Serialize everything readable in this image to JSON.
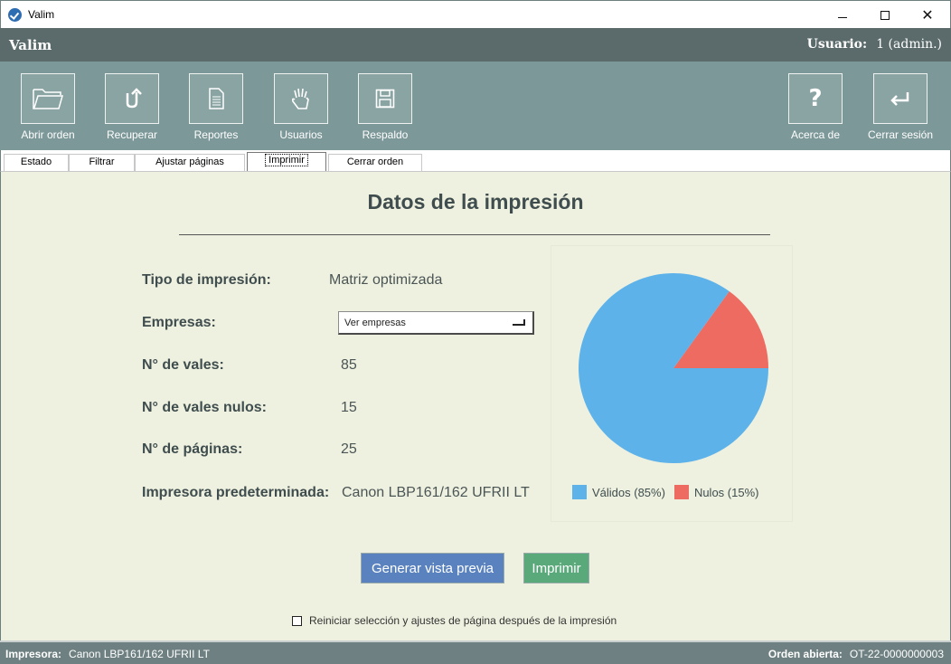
{
  "window": {
    "title": "Valim"
  },
  "header": {
    "app_name": "Valim",
    "user_label": "Usuario:",
    "user_value": "1 (admin.)"
  },
  "toolbar": {
    "left": [
      {
        "label": "Abrir orden",
        "icon": "folder-icon"
      },
      {
        "label": "Recuperar",
        "icon": "undo-icon"
      },
      {
        "label": "Reportes",
        "icon": "document-icon"
      },
      {
        "label": "Usuarios",
        "icon": "hand-icon"
      },
      {
        "label": "Respaldo",
        "icon": "floppy-disk-icon"
      }
    ],
    "right": [
      {
        "label": "Acerca de",
        "icon": "question-icon"
      },
      {
        "label": "Cerrar sesión",
        "icon": "return-icon"
      }
    ]
  },
  "tabs": [
    {
      "label": "Estado"
    },
    {
      "label": "Filtrar"
    },
    {
      "label": "Ajustar páginas"
    },
    {
      "label": "Imprimir",
      "active": true
    },
    {
      "label": "Cerrar orden"
    }
  ],
  "main": {
    "heading": "Datos de la impresión",
    "rows": [
      {
        "label": "Tipo de impresión:",
        "value": "Matriz optimizada"
      },
      {
        "label": "Empresas:",
        "value": ""
      },
      {
        "label": "N° de vales:",
        "value": "85"
      },
      {
        "label": "N° de vales nulos:",
        "value": "15"
      },
      {
        "label": "N° de páginas:",
        "value": "25"
      },
      {
        "label": "Impresora predeterminada:",
        "value": "Canon LBP161/162 UFRII LT"
      }
    ],
    "empresas_select": "Ver empresas",
    "preview_button": "Generar vista previa",
    "print_button": "Imprimir",
    "reset_checkbox_label": "Reiniciar selección y ajustes de página después de la impresión",
    "reset_checked": false
  },
  "chart_data": {
    "type": "pie",
    "categories": [
      "Válidos (85%)",
      "Nulos (15%)"
    ],
    "values": [
      85,
      15
    ],
    "colors": [
      "#5eb2ea",
      "#ee6b62"
    ],
    "legend": "bottom"
  },
  "statusbar": {
    "printer_label": "Impresora:",
    "printer_value": "Canon LBP161/162 UFRII LT",
    "order_label": "Orden abierta:",
    "order_value": "OT-22-0000000003"
  },
  "colors": {
    "header": "#5b6b6c",
    "toolbar": "#7d9899",
    "content_bg": "#eff1e0",
    "preview_btn": "#5a82bf",
    "print_btn": "#5aa97b"
  }
}
